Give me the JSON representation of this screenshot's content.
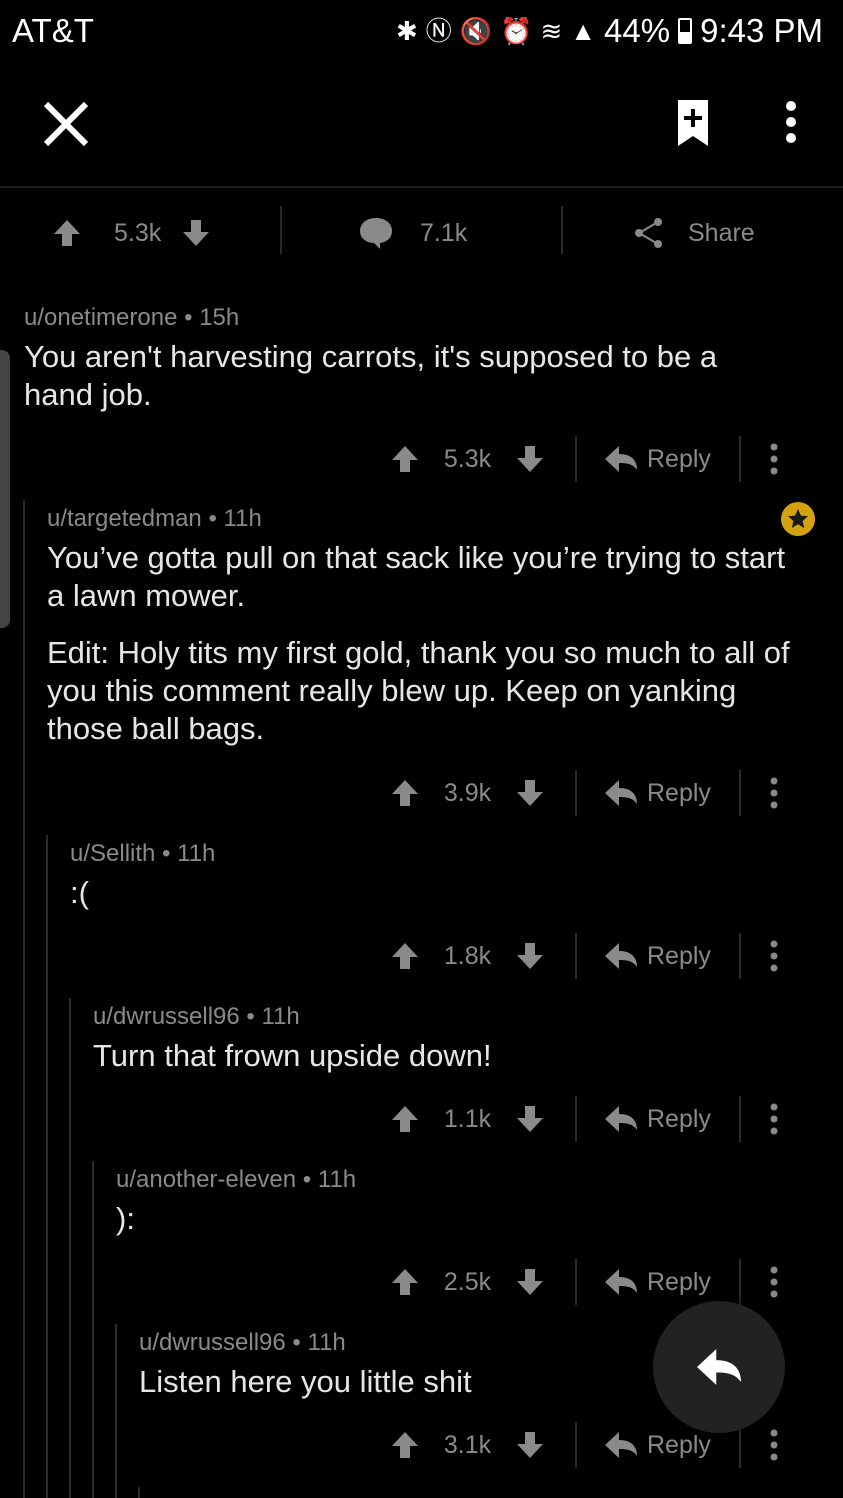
{
  "status_bar": {
    "carrier": "AT&T",
    "battery": "44%",
    "time": "9:43 PM"
  },
  "post_bar": {
    "score": "5.3k",
    "comments": "7.1k",
    "share": "Share"
  },
  "comments": [
    {
      "author": "u/onetimerone",
      "age": "15h",
      "body": "You aren't harvesting carrots, it's supposed to be a hand job.",
      "score": "5.3k",
      "reply": "Reply"
    },
    {
      "author": "u/targetedman",
      "age": "11h",
      "body": "You’ve gotta pull on that sack like you’re trying to start a lawn mower.",
      "edit": "Edit: Holy tits my first gold, thank you so much to all of you this comment really blew up. Keep on yanking those ball bags.",
      "score": "3.9k",
      "reply": "Reply"
    },
    {
      "author": "u/Sellith",
      "age": "11h",
      "body": ":(",
      "score": "1.8k",
      "reply": "Reply"
    },
    {
      "author": "u/dwrussell96",
      "age": "11h",
      "body": "Turn that frown upside down!",
      "score": "1.1k",
      "reply": "Reply"
    },
    {
      "author": "u/another-eleven",
      "age": "11h",
      "body": "):",
      "score": "2.5k",
      "reply": "Reply"
    },
    {
      "author": "u/dwrussell96",
      "age": "11h",
      "body": "Listen here you little shit",
      "score": "3.1k",
      "reply": "Reply"
    }
  ],
  "colors": {
    "background": "#000000",
    "text": "#e4e6e8",
    "muted": "#8a8a8a",
    "gold": "#d4a20f"
  },
  "icons": [
    "close-icon",
    "bookmark-add-icon",
    "more-vertical-icon",
    "upvote-icon",
    "downvote-icon",
    "comment-icon",
    "share-icon",
    "reply-icon",
    "gold-award-icon"
  ]
}
